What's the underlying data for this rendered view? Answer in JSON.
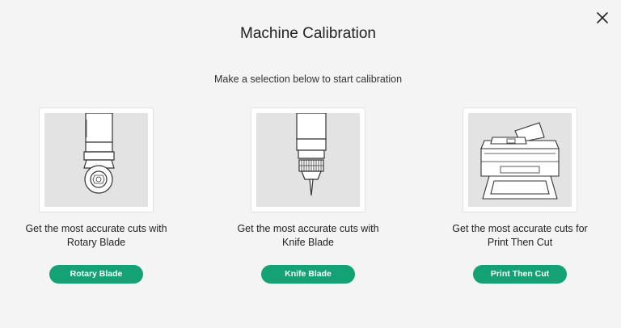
{
  "dialog": {
    "title": "Machine Calibration",
    "subtitle": "Make a selection below to start calibration",
    "close_icon": "close-icon"
  },
  "options": [
    {
      "image": "rotary-blade-image",
      "desc_line1": "Get the most accurate cuts with",
      "desc_line2": "Rotary Blade",
      "button": "Rotary Blade"
    },
    {
      "image": "knife-blade-image",
      "desc_line1": "Get the most accurate cuts with",
      "desc_line2": "Knife Blade",
      "button": "Knife Blade"
    },
    {
      "image": "printer-image",
      "desc_line1": "Get the most accurate cuts for",
      "desc_line2": "Print Then Cut",
      "button": "Print Then Cut"
    }
  ],
  "colors": {
    "background": "#f4f4f4",
    "accent": "#14a173",
    "thumb_bg": "#e3e3e3"
  }
}
